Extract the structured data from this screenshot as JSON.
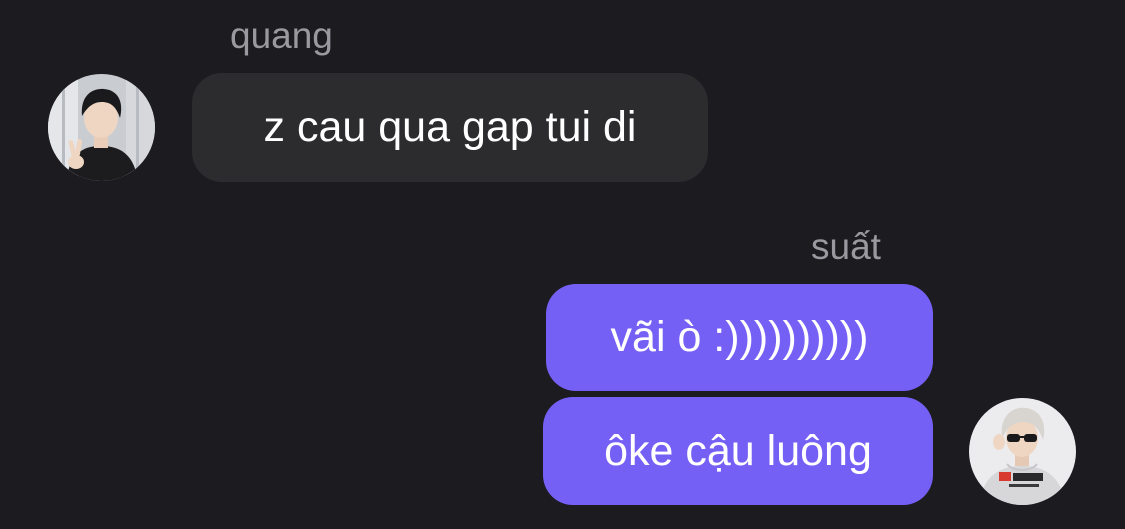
{
  "conversation": {
    "messages": [
      {
        "sender": "quang",
        "direction": "incoming",
        "text": "z cau qua gap tui di",
        "avatar_icon": "user-avatar-photo"
      },
      {
        "sender": "suất",
        "direction": "outgoing",
        "text": "vãi ò :))))))))))",
        "avatar_icon": ""
      },
      {
        "sender": "",
        "direction": "outgoing",
        "text": "ôke cậu luông",
        "avatar_icon": "user-avatar-photo"
      }
    ]
  },
  "colors": {
    "background": "#1c1b1f",
    "incoming_bubble": "#2c2c2f",
    "outgoing_bubble": "#7560f5",
    "sender_name": "#9a99a0",
    "message_text": "#ffffff"
  }
}
